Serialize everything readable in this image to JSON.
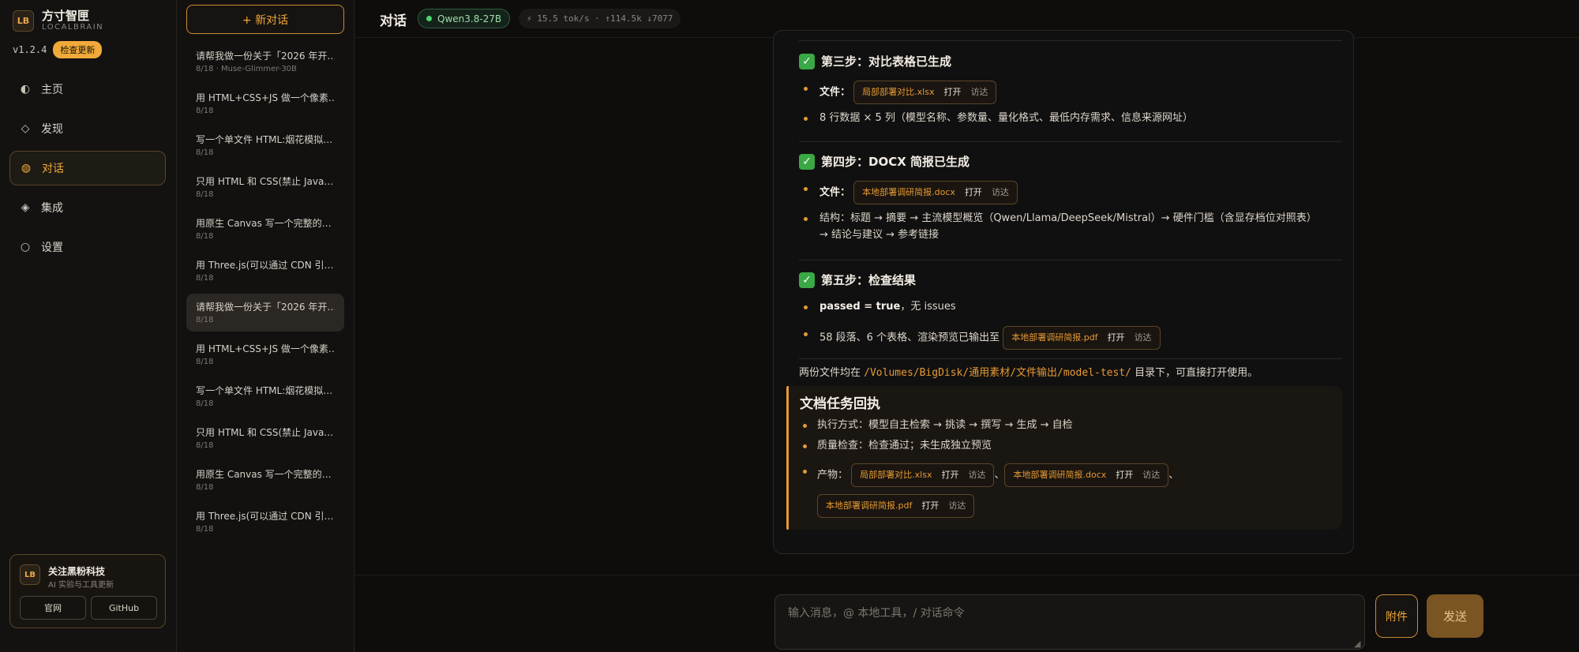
{
  "brand": {
    "logo": "LB",
    "name": "方寸智匣",
    "subtitle": "LOCALBRAIN",
    "version": "v1.2.4",
    "update_label": "检查更新"
  },
  "nav": [
    {
      "label": "主页",
      "icon": "half-circle-icon"
    },
    {
      "label": "发现",
      "icon": "diamond-icon"
    },
    {
      "label": "对话",
      "icon": "chat-dot-icon",
      "active": true
    },
    {
      "label": "集成",
      "icon": "diamond-filled-icon"
    },
    {
      "label": "设置",
      "icon": "circle-icon"
    }
  ],
  "follow": {
    "logo": "LB",
    "title": "关注黑粉科技",
    "subtitle": "AI 实验与工具更新",
    "site_label": "官网",
    "github_label": "GitHub"
  },
  "history": {
    "new_chat_label": "+ 新对话",
    "items": [
      {
        "title": "请帮我做一份关于「2026 年开…",
        "meta": "8/18 · Muse-Glimmer-30B"
      },
      {
        "title": "用 HTML+CSS+JS 做一个像素…",
        "meta": "8/18"
      },
      {
        "title": "写一个单文件 HTML:烟花模拟…",
        "meta": "8/18"
      },
      {
        "title": "只用 HTML 和 CSS(禁止 Java…",
        "meta": "8/18"
      },
      {
        "title": "用原生 Canvas 写一个完整的…",
        "meta": "8/18"
      },
      {
        "title": "用 Three.js(可以通过 CDN 引…",
        "meta": "8/18"
      },
      {
        "title": "请帮我做一份关于「2026 年开…",
        "meta": "8/18",
        "selected": true
      },
      {
        "title": "用 HTML+CSS+JS 做一个像素…",
        "meta": "8/18"
      },
      {
        "title": "写一个单文件 HTML:烟花模拟…",
        "meta": "8/18"
      },
      {
        "title": "只用 HTML 和 CSS(禁止 Java…",
        "meta": "8/18"
      },
      {
        "title": "用原生 Canvas 写一个完整的…",
        "meta": "8/18"
      },
      {
        "title": "用 Three.js(可以通过 CDN 引…",
        "meta": "8/18"
      }
    ]
  },
  "header": {
    "title": "对话",
    "model": "Qwen3.8-27B",
    "stats": "⚡ 15.5 tok/s · ↑114.5k ↓7077"
  },
  "message": {
    "step3": {
      "heading": "第三步：对比表格已生成",
      "file_label": "文件：",
      "file": "局部部署对比.xlsx",
      "detail": "8 行数据 × 5 列（模型名称、参数量、量化格式、最低内存需求、信息来源网址）"
    },
    "step4": {
      "heading": "第四步：DOCX 简报已生成",
      "file_label": "文件：",
      "file": "本地部署调研简报.docx",
      "structure_line1": "结构：标题 → 摘要 → 主流模型概览（Qwen/Llama/DeepSeek/Mistral）→ 硬件门槛（含显存档位对照表）",
      "structure_line2": "→ 结论与建议 → 参考链接"
    },
    "step5": {
      "heading": "第五步：检查结果",
      "passed_bold": "passed = true",
      "passed_rest": "，无 issues",
      "render_text": "58 段落、6 个表格、渲染预览已输出至",
      "file": "本地部署调研简报.pdf"
    },
    "footer": {
      "prefix": "两份文件均在",
      "path": "/Volumes/BigDisk/通用素材/文件输出/model-test/",
      "suffix": "目录下，可直接打开使用。"
    },
    "receipt": {
      "heading": "文档任务回执",
      "exec": "执行方式：模型自主检索 → 挑读 → 撰写 → 生成 → 自检",
      "quality": "质量检查：检查通过；未生成独立预览",
      "products_label": "产物：",
      "separator": "、",
      "files": [
        "局部部署对比.xlsx",
        "本地部署调研简报.docx",
        "本地部署调研简报.pdf"
      ]
    },
    "chip_open": "打开",
    "chip_reveal": "访达"
  },
  "composer": {
    "placeholder": "输入消息，@ 本地工具，/ 对话命令",
    "attach_label": "附件",
    "send_label": "发送"
  },
  "colors": {
    "accent": "#f0a93a",
    "background": "#0e0d0c",
    "success": "#3aa845"
  }
}
